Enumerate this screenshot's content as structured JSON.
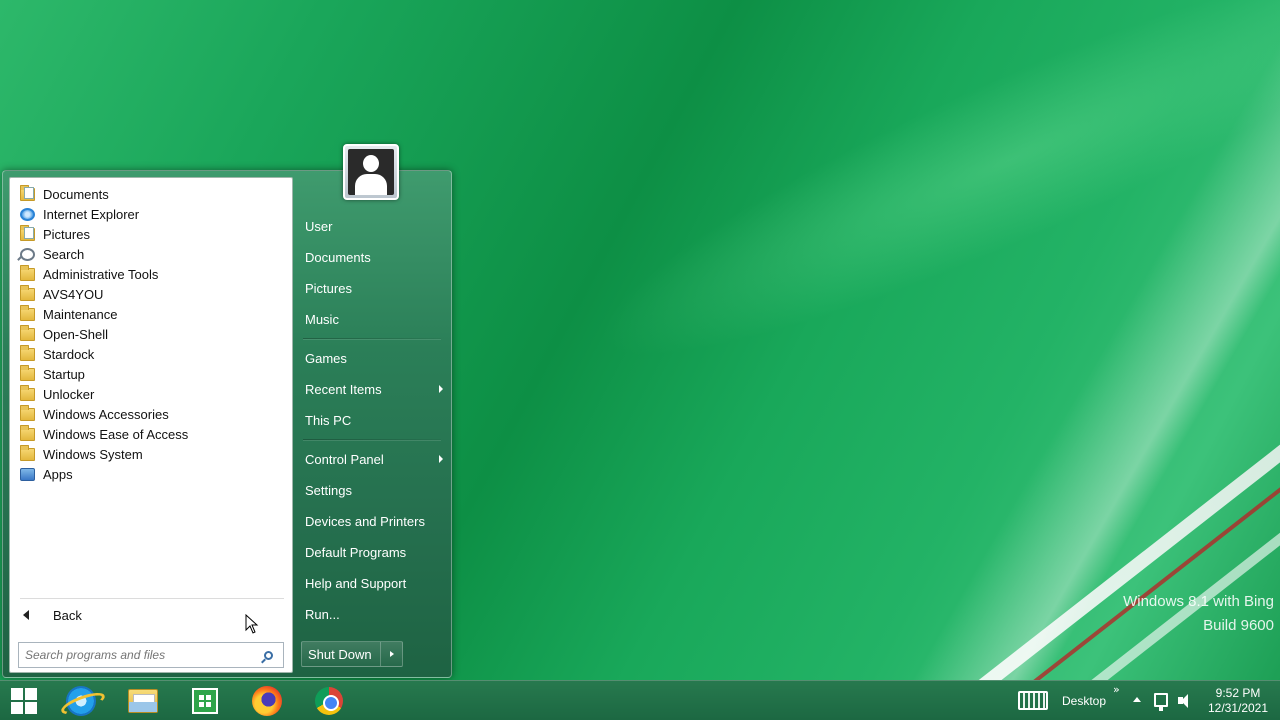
{
  "watermark": {
    "line1": "Windows 8.1 with Bing",
    "line2": "Build 9600"
  },
  "start_menu": {
    "programs": [
      {
        "label": "Documents",
        "icon": "documents-folder-icon"
      },
      {
        "label": "Internet Explorer",
        "icon": "internet-explorer-icon"
      },
      {
        "label": "Pictures",
        "icon": "pictures-folder-icon"
      },
      {
        "label": "Search",
        "icon": "search-icon"
      },
      {
        "label": "Administrative Tools",
        "icon": "folder-icon"
      },
      {
        "label": "AVS4YOU",
        "icon": "folder-icon"
      },
      {
        "label": "Maintenance",
        "icon": "folder-icon"
      },
      {
        "label": "Open-Shell",
        "icon": "folder-icon"
      },
      {
        "label": "Stardock",
        "icon": "folder-icon"
      },
      {
        "label": "Startup",
        "icon": "folder-icon"
      },
      {
        "label": "Unlocker",
        "icon": "folder-icon"
      },
      {
        "label": "Windows Accessories",
        "icon": "folder-icon"
      },
      {
        "label": "Windows Ease of Access",
        "icon": "folder-icon"
      },
      {
        "label": "Windows System",
        "icon": "folder-icon"
      },
      {
        "label": "Apps",
        "icon": "apps-icon"
      }
    ],
    "back_label": "Back",
    "search_placeholder": "Search programs and files",
    "right_items": {
      "user": "User",
      "documents": "Documents",
      "pictures": "Pictures",
      "music": "Music",
      "games": "Games",
      "recent_items": "Recent Items",
      "this_pc": "This PC",
      "control_panel": "Control Panel",
      "settings": "Settings",
      "devices_printers": "Devices and Printers",
      "default_programs": "Default Programs",
      "help_support": "Help and Support",
      "run": "Run..."
    },
    "shutdown_label": "Shut Down"
  },
  "taskbar": {
    "desktop_label": "Desktop",
    "chevron": "»",
    "time": "9:52 PM",
    "date": "12/31/2021"
  }
}
